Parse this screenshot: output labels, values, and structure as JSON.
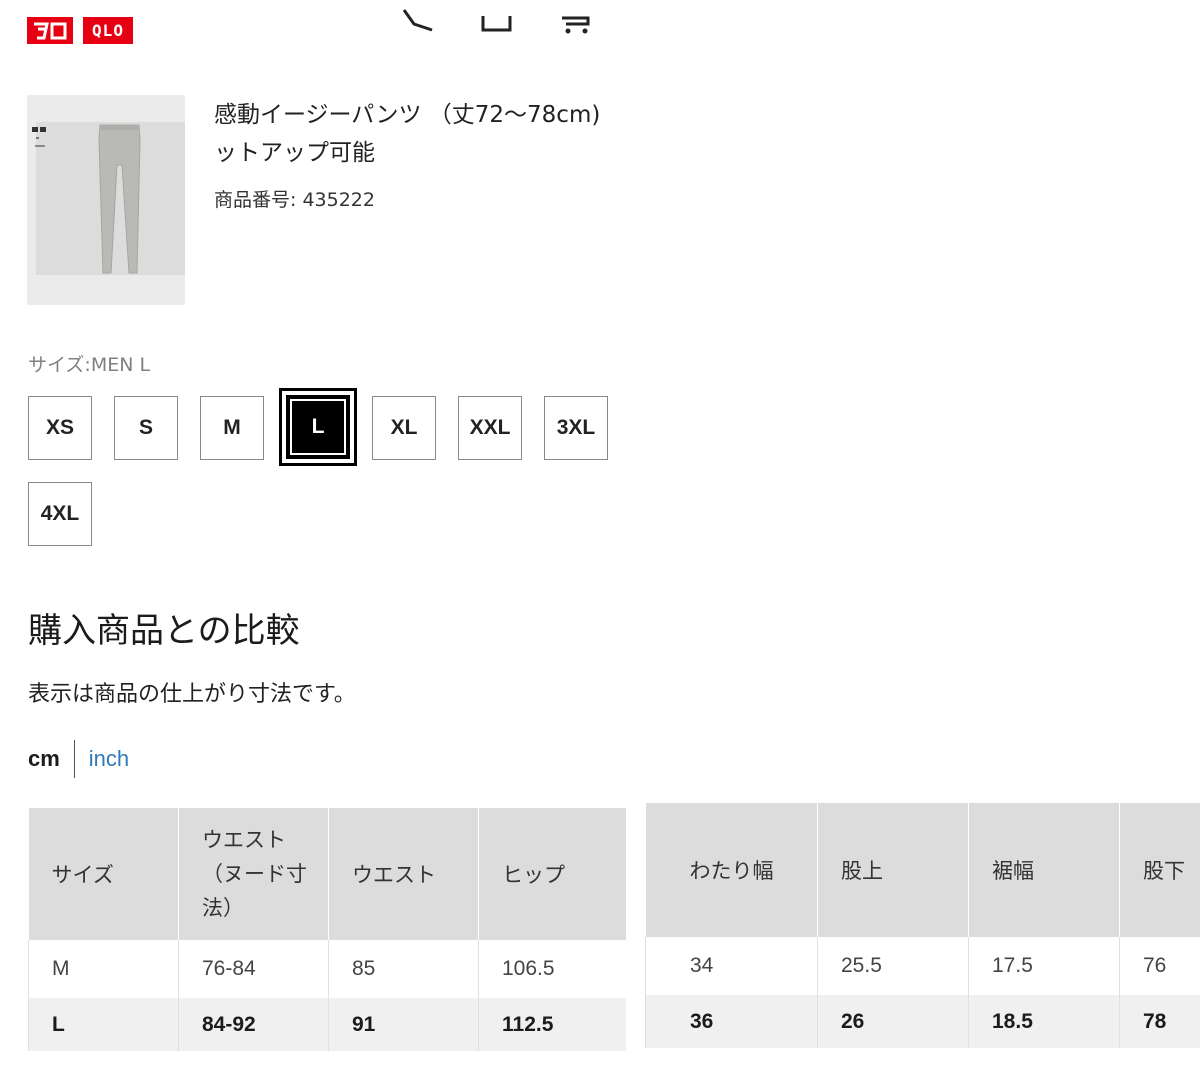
{
  "header": {
    "logo_left": "ユニ",
    "logo_right": "QLO",
    "brand_color": "#e60012",
    "icons": [
      "search-icon",
      "favorites-icon",
      "cart-icon"
    ]
  },
  "product": {
    "title_line1": "感動イージーパンツ （丈72〜78cm)",
    "title_line2": "ットアップ可能",
    "number_label": "商品番号",
    "number_value": ": 435222"
  },
  "size_selector": {
    "label": "サイズ:MEN L",
    "options": [
      "XS",
      "S",
      "M",
      "L",
      "XL",
      "XXL",
      "3XL",
      "4XL"
    ],
    "selected": "L"
  },
  "comparison": {
    "heading": "購入商品との比較",
    "note": "表示は商品の仕上がり寸法です。",
    "unit_cm": "cm",
    "unit_inch": "inch"
  },
  "table_left": {
    "headers": [
      "サイズ",
      "ウエスト（ヌード寸法）",
      "ウエスト",
      "ヒップ"
    ],
    "rows": [
      [
        "M",
        "76-84",
        "85",
        "106.5"
      ],
      [
        "L",
        "84-92",
        "91",
        "112.5"
      ]
    ]
  },
  "table_right": {
    "headers": [
      "わたり幅",
      "股上",
      "裾幅",
      "股下"
    ],
    "rows": [
      [
        "34",
        "25.5",
        "17.5",
        "76"
      ],
      [
        "36",
        "26",
        "18.5",
        "78"
      ]
    ]
  }
}
